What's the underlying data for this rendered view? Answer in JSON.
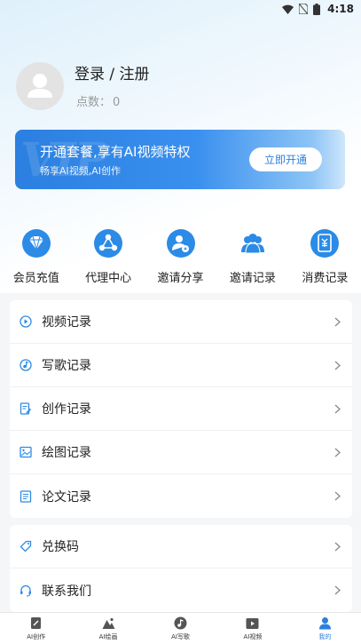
{
  "status_bar": {
    "time": "4:18"
  },
  "profile": {
    "login_label": "登录 / 注册",
    "points_label": "点数：",
    "points_value": "0"
  },
  "banner": {
    "watermark": "VIP",
    "title": "开通套餐,享有AI视频特权",
    "subtitle": "畅享AI视频,AI创作",
    "button": "立即开通"
  },
  "quick_actions": [
    {
      "label": "会员充值",
      "icon": "diamond-icon"
    },
    {
      "label": "代理中心",
      "icon": "network-icon"
    },
    {
      "label": "邀请分享",
      "icon": "share-user-icon"
    },
    {
      "label": "邀请记录",
      "icon": "users-icon"
    },
    {
      "label": "消费记录",
      "icon": "receipt-icon"
    }
  ],
  "menu_group_1": [
    {
      "label": "视频记录",
      "icon": "play-circle-icon"
    },
    {
      "label": "写歌记录",
      "icon": "music-disc-icon"
    },
    {
      "label": "创作记录",
      "icon": "edit-doc-icon"
    },
    {
      "label": "绘图记录",
      "icon": "image-icon"
    },
    {
      "label": "论文记录",
      "icon": "paper-icon"
    }
  ],
  "menu_group_2": [
    {
      "label": "兑换码",
      "icon": "tag-icon"
    },
    {
      "label": "联系我们",
      "icon": "headset-icon"
    }
  ],
  "tabbar": [
    {
      "label": "AI创作",
      "icon": "create-icon",
      "active": false
    },
    {
      "label": "AI绘画",
      "icon": "paint-icon",
      "active": false
    },
    {
      "label": "AI写歌",
      "icon": "music-icon",
      "active": false
    },
    {
      "label": "AI视频",
      "icon": "video-icon",
      "active": false
    },
    {
      "label": "我的",
      "icon": "profile-icon",
      "active": true
    }
  ],
  "colors": {
    "accent": "#2b7fe0",
    "icon_bg": "#2b8be6"
  }
}
